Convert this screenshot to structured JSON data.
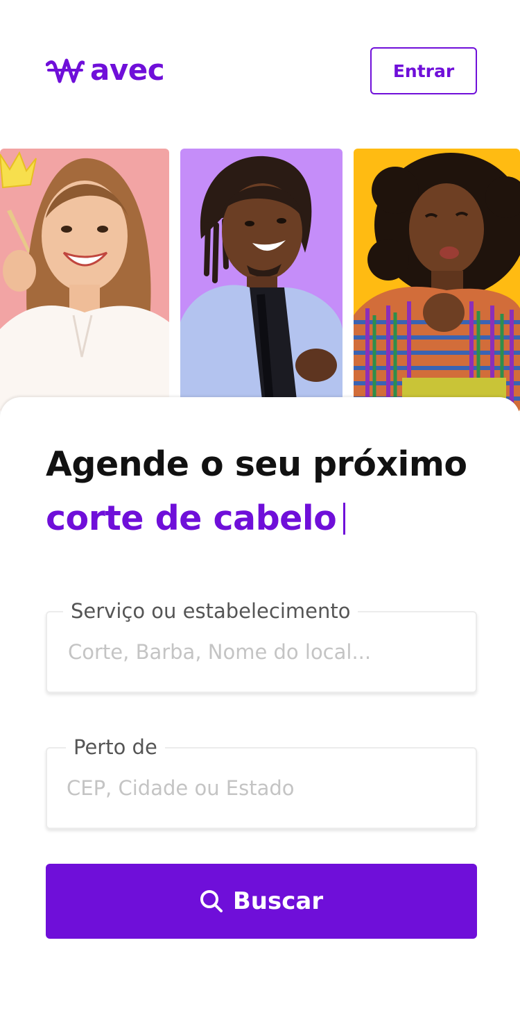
{
  "header": {
    "logo_text": "avec",
    "login_label": "Entrar"
  },
  "hero": {
    "headline": "Agende o seu próximo",
    "highlight": "corte de cabelo"
  },
  "form": {
    "service": {
      "label": "Serviço ou estabelecimento",
      "placeholder": "Corte, Barba, Nome do local..."
    },
    "location": {
      "label": "Perto de",
      "placeholder": "CEP, Cidade ou Estado"
    },
    "search_label": "Buscar"
  },
  "colors": {
    "brand": "#6f0fd9",
    "photo_1_bg": "#f2a4a4",
    "photo_2_bg": "#c58df9",
    "photo_3_bg": "#ffbb12"
  }
}
